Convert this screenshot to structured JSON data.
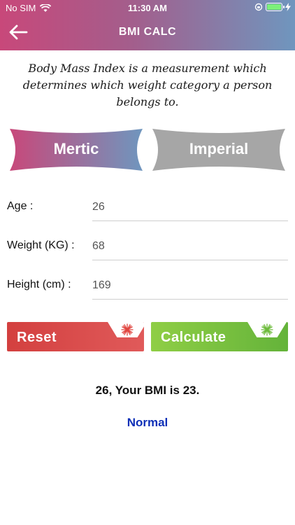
{
  "status_bar": {
    "carrier": "No SIM",
    "time": "11:30 AM"
  },
  "nav": {
    "title": "BMI CALC"
  },
  "description": "Body Mass Index is a measurement which determines which weight category a person belongs to.",
  "unit_tabs": {
    "metric_label": "Mertic",
    "imperial_label": "Imperial"
  },
  "form": {
    "age_label": "Age :",
    "age_value": "26",
    "weight_label": "Weight (KG) :",
    "weight_value": "68",
    "height_label": "Height (cm) :",
    "height_value": "169"
  },
  "actions": {
    "reset_label": "Reset",
    "calculate_label": "Calculate"
  },
  "result": {
    "summary": "26, Your BMI is 23.",
    "category": "Normal"
  },
  "colors": {
    "header_start": "#c8487a",
    "header_end": "#6f96be",
    "reset": "#d3403f",
    "calculate": "#7cc23f",
    "category_text": "#0d2fb7",
    "imperial_tab": "#a6a6a6"
  }
}
